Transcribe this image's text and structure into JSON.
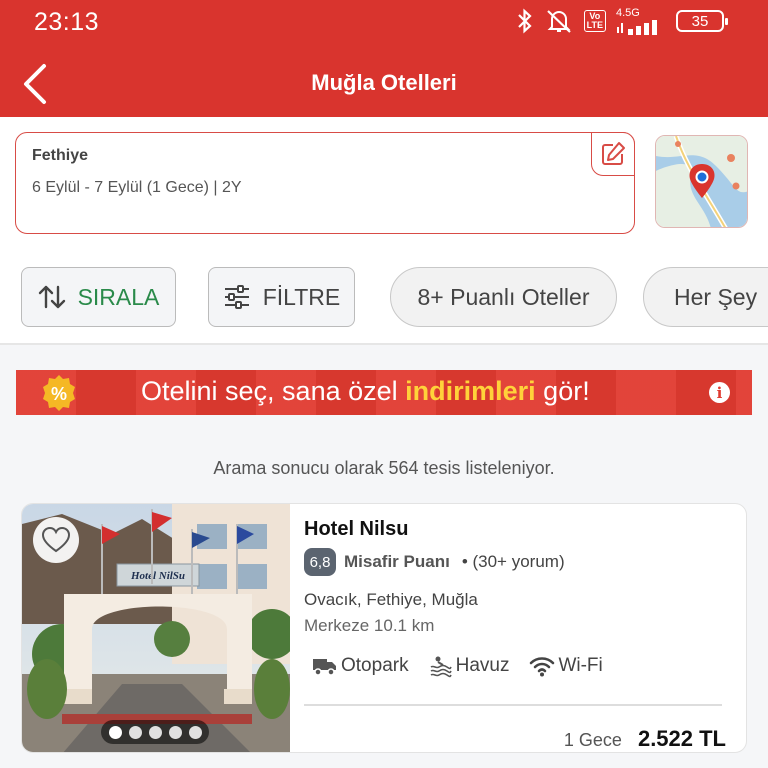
{
  "status_bar": {
    "time": "23:13",
    "volte_label": "Vo\nLTE",
    "network_label": "4.5G",
    "battery_level": "35"
  },
  "header": {
    "title": "Muğla Otelleri",
    "back_icon": "chevron-left-icon"
  },
  "search": {
    "city": "Fethiye",
    "details": "6 Eylül - 7 Eylül (1 Gece) | 2Y",
    "edit_icon": "edit-icon",
    "map_icon": "map-pin-icon"
  },
  "chips": {
    "sort_label": "SIRALA",
    "filter_label": "FİLTRE",
    "pills": [
      "8+ Puanlı Oteller",
      "Her Şey"
    ]
  },
  "banner": {
    "badge_text": "%",
    "text_before": "Otelini seç, sana özel ",
    "text_highlight": "indirimleri",
    "text_after": " gör!",
    "info_icon": "i"
  },
  "results": {
    "count_text": "Arama sonucu olarak 564 tesis listeleniyor."
  },
  "hotel": {
    "name": "Hotel Nilsu",
    "sign_text": "Hotel NilSu",
    "score": "6,8",
    "score_label": "Misafir Puanı",
    "reviews": "• (30+ yorum)",
    "location": "Ovacık, Fethiye, Muğla",
    "distance": "Merkeze 10.1 km",
    "amenities": [
      {
        "label": "Otopark",
        "icon": "truck-icon"
      },
      {
        "label": "Havuz",
        "icon": "pool-icon"
      },
      {
        "label": "Wi-Fi",
        "icon": "wifi-icon"
      }
    ],
    "nights": "1 Gece",
    "price": "2.522 TL",
    "photo_count": 5,
    "active_photo": 1
  },
  "colors": {
    "brand_red": "#d9342e",
    "sort_green": "#2a8a4a",
    "highlight_yellow": "#ffd23a"
  }
}
